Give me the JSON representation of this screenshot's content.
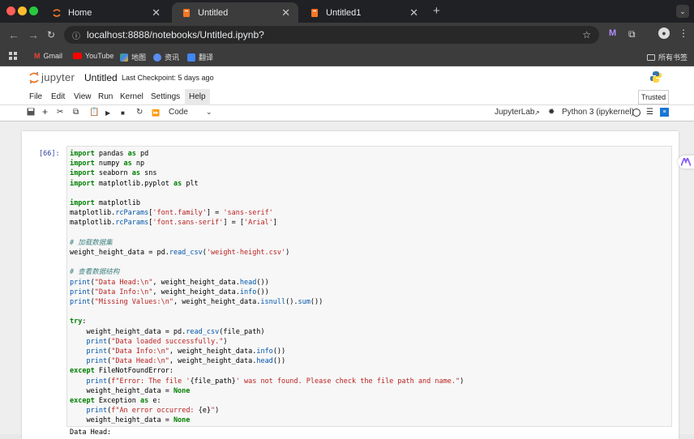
{
  "browser": {
    "tabs": [
      {
        "title": "Home",
        "icon": "jupyter-icon"
      },
      {
        "title": "Untitled",
        "icon": "notebook-icon"
      },
      {
        "title": "Untitled1",
        "icon": "notebook-icon"
      }
    ],
    "url": "localhost:8888/notebooks/Untitled.ipynb?",
    "bookmarks": [
      "Gmail",
      "YouTube",
      "地图",
      "资讯",
      "翻译"
    ],
    "all_bookmarks": "所有书签"
  },
  "jupyter": {
    "logo": "jupyter",
    "title": "Untitled",
    "checkpoint": "Last Checkpoint: 5 days ago",
    "trusted": "Trusted",
    "menu": [
      "File",
      "Edit",
      "View",
      "Run",
      "Kernel",
      "Settings",
      "Help"
    ],
    "cell_type": "Code",
    "jupyterlab": "JupyterLab",
    "kernel": "Python 3 (ipykernel)"
  },
  "cell": {
    "prompt": "[66]:",
    "output_head": "Data Head:"
  }
}
